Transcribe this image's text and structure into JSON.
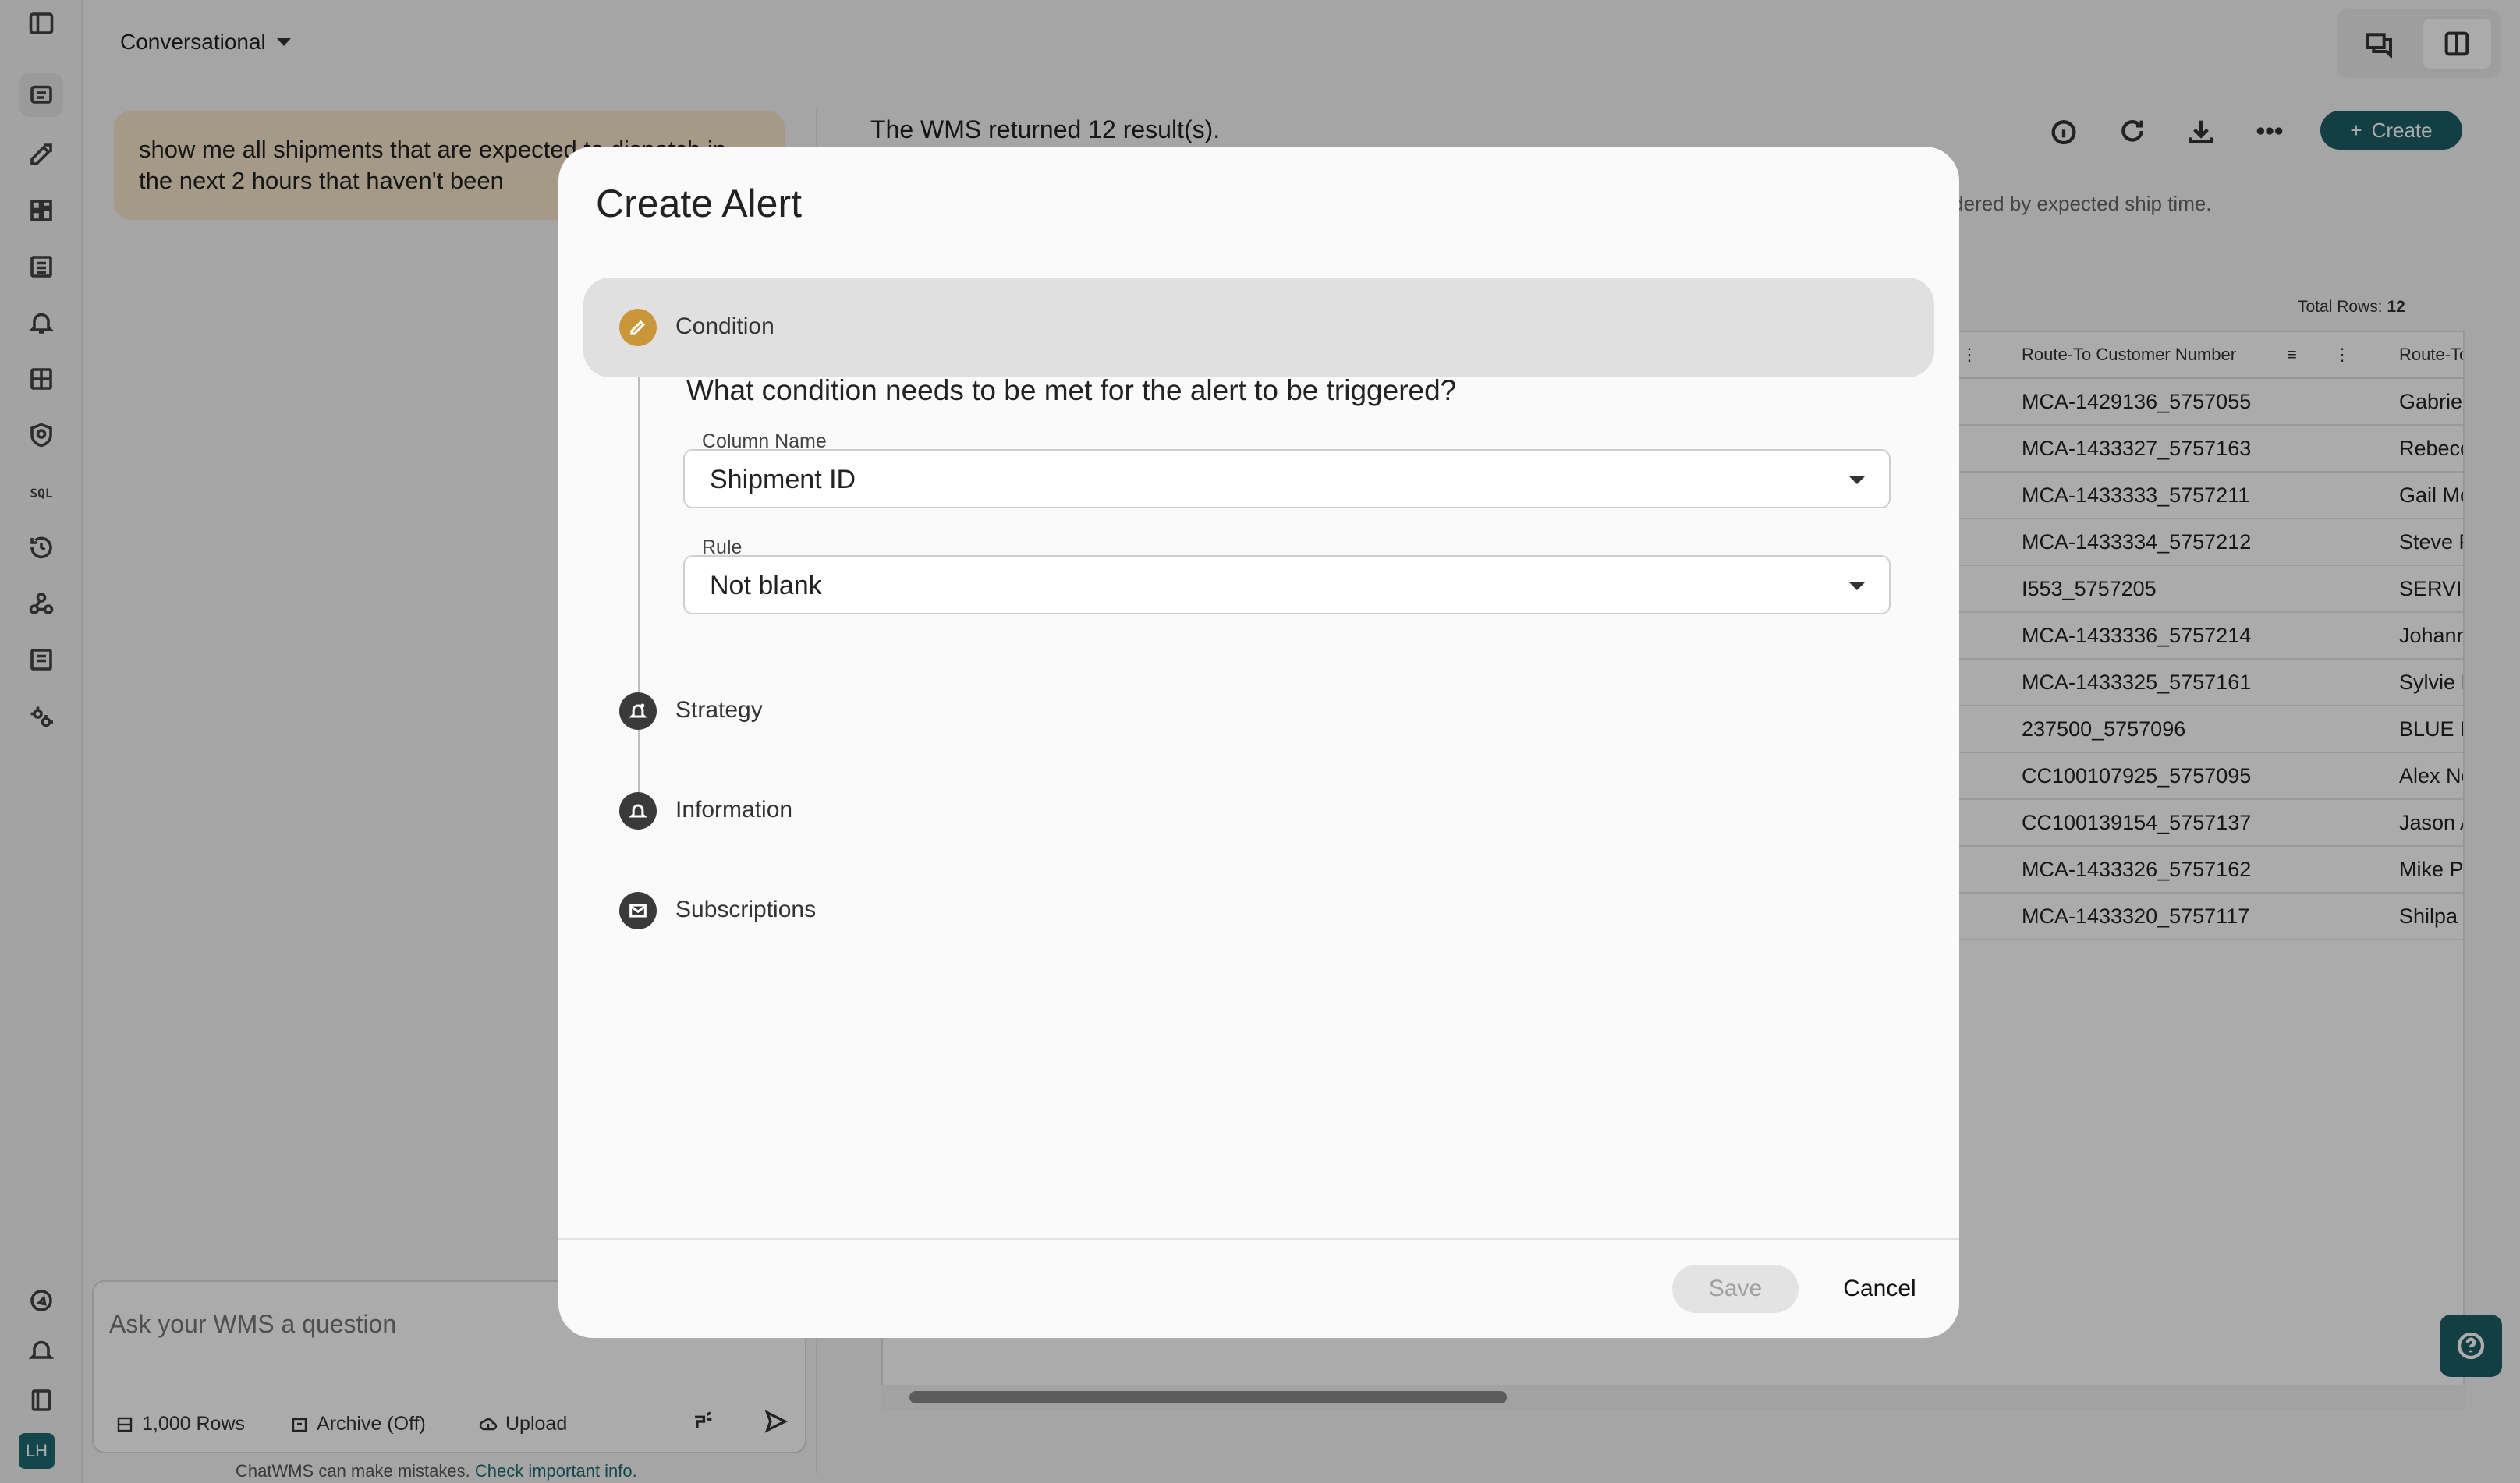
{
  "chat": {
    "mode_label": "Conversational",
    "user_message": "show me all shipments that are expected to dispatch in the next 2 hours that haven't been",
    "input_placeholder": "Ask your WMS a question",
    "chips": [
      "1,000 Rows",
      "Archive (Off)",
      "Upload"
    ],
    "disclaimer": "ChatWMS can make mistakes.",
    "disclaimer_link": "Check important info."
  },
  "result": {
    "title": "The WMS returned 12 result(s).",
    "subtitle_fragment": "ordered by expected ship time.",
    "create_label": "Create",
    "total_label": "Total Rows:",
    "total_value": "12",
    "columns": [
      "Route-To Customer Number",
      "Route-To"
    ],
    "rows": [
      [
        "MCA-1429136_5757055",
        "Gabriell"
      ],
      [
        "MCA-1433327_5757163",
        "Rebecca"
      ],
      [
        "MCA-1433333_5757211",
        "Gail Mo"
      ],
      [
        "MCA-1433334_5757212",
        "Steve P"
      ],
      [
        "I553_5757205",
        "SERVICI"
      ],
      [
        "MCA-1433336_5757214",
        "Johann"
      ],
      [
        "MCA-1433325_5757161",
        "Sylvie M"
      ],
      [
        "237500_5757096",
        "BLUE M"
      ],
      [
        "CC100107925_5757095",
        "Alex Ne"
      ],
      [
        "CC100139154_5757137",
        "Jason A"
      ],
      [
        "MCA-1433326_5757162",
        "Mike Pe"
      ],
      [
        "MCA-1433320_5757117",
        "Shilpa N"
      ]
    ]
  },
  "modal": {
    "title": "Create Alert",
    "steps": [
      {
        "label": "Condition",
        "icon": "pencil-icon",
        "color": "#c9963a"
      },
      {
        "label": "Strategy",
        "icon": "bell-plus-icon",
        "color": "#3a3a3a"
      },
      {
        "label": "Information",
        "icon": "bell-icon",
        "color": "#3a3a3a"
      },
      {
        "label": "Subscriptions",
        "icon": "mail-icon",
        "color": "#3a3a3a"
      }
    ],
    "question": "What condition needs to be met for the alert to be triggered?",
    "column_name_label": "Column Name",
    "column_name_value": "Shipment ID",
    "rule_label": "Rule",
    "rule_value": "Not blank",
    "save_label": "Save",
    "cancel_label": "Cancel"
  },
  "avatar_initials": "LH",
  "colors": {
    "accent": "#1d5d64",
    "condition_step": "#c9963a"
  }
}
